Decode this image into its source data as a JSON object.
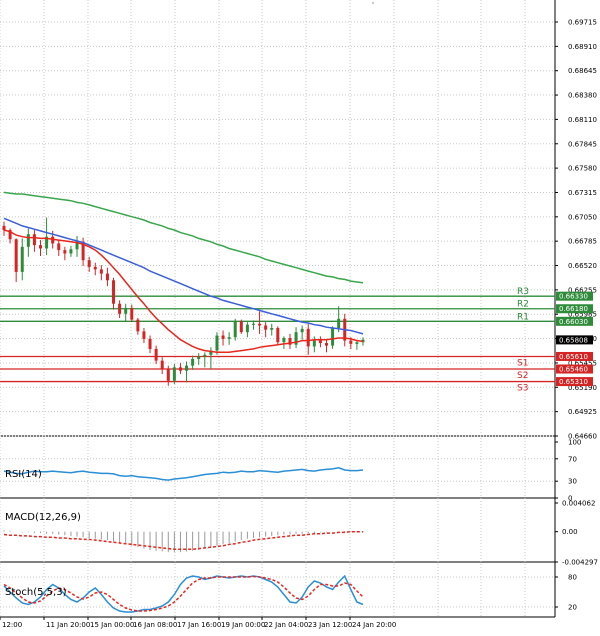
{
  "colors": {
    "bull": "#2e8b3a",
    "bear": "#d42424",
    "ma_fast": "#e8261c",
    "ma_mid": "#3a5fd9",
    "ma_slow": "#3aa64c",
    "support": "#d42424",
    "resistance": "#2e8b3a",
    "rsi": "#2a8fd6",
    "stoch_main": "#2a8fd6",
    "stoch_signal": "#e8261c",
    "macd_hist": "#9a9a9a",
    "macd_signal": "#e8261c",
    "grid": "#000000",
    "price_box": "#000000"
  },
  "chart_data": [
    {
      "type": "candlestick",
      "panel": "price",
      "ylim": [
        0.6466,
        0.6982
      ],
      "y_ticks": [
        "0.69715",
        "0.68910",
        "0.68645",
        "0.68380",
        "0.68110",
        "0.67845",
        "0.67580",
        "0.67315",
        "0.67050",
        "0.66785",
        "0.66520",
        "0.66255",
        "0.65985",
        "0.65720",
        "0.65455",
        "0.65190",
        "0.64925",
        "0.64660"
      ],
      "x_ticks": [
        "12:00",
        "11 Jan 20:00",
        "15 Jan 00:00",
        "16 Jan 08:00",
        "17 Jan 16:00",
        "19 Jan 00:00",
        "22 Jan 04:00",
        "23 Jan 12:00",
        "24 Jan 20:00"
      ],
      "last_price": "0.65808",
      "levels": [
        {
          "name": "R3",
          "value": 0.6633,
          "label": "0.66330",
          "kind": "resistance"
        },
        {
          "name": "R2",
          "value": 0.6618,
          "label": "0.66180",
          "kind": "resistance"
        },
        {
          "name": "R1",
          "value": 0.6603,
          "label": "0.66030",
          "kind": "resistance"
        },
        {
          "name": "S1",
          "value": 0.6561,
          "label": "0.65610",
          "kind": "support"
        },
        {
          "name": "S2",
          "value": 0.6546,
          "label": "0.65460",
          "kind": "support"
        },
        {
          "name": "S3",
          "value": 0.6531,
          "label": "0.65310",
          "kind": "support"
        }
      ],
      "candles": [
        [
          0.6717,
          0.6722,
          0.6705,
          0.6712
        ],
        [
          0.6712,
          0.6714,
          0.6696,
          0.6701
        ],
        [
          0.6701,
          0.6702,
          0.665,
          0.6662
        ],
        [
          0.6662,
          0.6702,
          0.6652,
          0.6692
        ],
        [
          0.6692,
          0.6714,
          0.668,
          0.6707
        ],
        [
          0.6707,
          0.6712,
          0.6686,
          0.6694
        ],
        [
          0.6694,
          0.67,
          0.6681,
          0.669
        ],
        [
          0.669,
          0.6727,
          0.6682,
          0.6704
        ],
        [
          0.6704,
          0.6711,
          0.669,
          0.6696
        ],
        [
          0.6696,
          0.67,
          0.6681,
          0.6688
        ],
        [
          0.6688,
          0.6692,
          0.6676,
          0.6684
        ],
        [
          0.6684,
          0.6693,
          0.668,
          0.6689
        ],
        [
          0.6689,
          0.6705,
          0.668,
          0.6698
        ],
        [
          0.6698,
          0.6703,
          0.6669,
          0.6676
        ],
        [
          0.6676,
          0.668,
          0.6662,
          0.6668
        ],
        [
          0.6668,
          0.6673,
          0.6658,
          0.6665
        ],
        [
          0.6665,
          0.667,
          0.6652,
          0.666
        ],
        [
          0.666,
          0.6667,
          0.6645,
          0.6652
        ],
        [
          0.6652,
          0.6655,
          0.6617,
          0.6624
        ],
        [
          0.6624,
          0.6628,
          0.6607,
          0.6612
        ],
        [
          0.6612,
          0.6624,
          0.6603,
          0.6619
        ],
        [
          0.6619,
          0.6623,
          0.6602,
          0.6605
        ],
        [
          0.6605,
          0.6607,
          0.6587,
          0.6591
        ],
        [
          0.6591,
          0.6595,
          0.6577,
          0.6582
        ],
        [
          0.6582,
          0.6586,
          0.6565,
          0.657
        ],
        [
          0.657,
          0.6574,
          0.6552,
          0.6556
        ],
        [
          0.6556,
          0.656,
          0.654,
          0.6546
        ],
        [
          0.6546,
          0.655,
          0.6526,
          0.6532
        ],
        [
          0.6532,
          0.6552,
          0.6528,
          0.6548
        ],
        [
          0.6548,
          0.6553,
          0.654,
          0.6544
        ],
        [
          0.6544,
          0.6555,
          0.653,
          0.655
        ],
        [
          0.655,
          0.6562,
          0.6545,
          0.6558
        ],
        [
          0.6558,
          0.6565,
          0.6551,
          0.6561
        ],
        [
          0.6561,
          0.6566,
          0.6548,
          0.6563
        ],
        [
          0.6563,
          0.6572,
          0.6546,
          0.6568
        ],
        [
          0.6568,
          0.659,
          0.6563,
          0.6586
        ],
        [
          0.6586,
          0.6592,
          0.6574,
          0.6582
        ],
        [
          0.6582,
          0.659,
          0.6575,
          0.6584
        ],
        [
          0.6584,
          0.6606,
          0.658,
          0.6603
        ],
        [
          0.6603,
          0.6605,
          0.6588,
          0.659
        ],
        [
          0.659,
          0.6602,
          0.6584,
          0.6599
        ],
        [
          0.6599,
          0.6604,
          0.6593,
          0.66
        ],
        [
          0.66,
          0.6615,
          0.6588,
          0.6598
        ],
        [
          0.6598,
          0.6602,
          0.6584,
          0.6593
        ],
        [
          0.6593,
          0.66,
          0.6586,
          0.6595
        ],
        [
          0.6595,
          0.6597,
          0.6575,
          0.6578
        ],
        [
          0.6578,
          0.6585,
          0.657,
          0.6583
        ],
        [
          0.6583,
          0.6588,
          0.657,
          0.6575
        ],
        [
          0.6575,
          0.6596,
          0.6571,
          0.659
        ],
        [
          0.659,
          0.6598,
          0.6581,
          0.6594
        ],
        [
          0.6594,
          0.66,
          0.6563,
          0.6573
        ],
        [
          0.6573,
          0.6585,
          0.6566,
          0.658
        ],
        [
          0.658,
          0.6585,
          0.6572,
          0.6577
        ],
        [
          0.6577,
          0.6582,
          0.6566,
          0.6574
        ],
        [
          0.6574,
          0.6597,
          0.657,
          0.6595
        ],
        [
          0.6595,
          0.6621,
          0.659,
          0.6606
        ],
        [
          0.6606,
          0.6612,
          0.6573,
          0.658
        ],
        [
          0.658,
          0.6584,
          0.657,
          0.6576
        ],
        [
          0.6576,
          0.658,
          0.6569,
          0.6578
        ],
        [
          0.6578,
          0.6584,
          0.6574,
          0.6581
        ]
      ],
      "ma_fast": [
        0.6712,
        0.671,
        0.6706,
        0.6704,
        0.6703,
        0.6703,
        0.6702,
        0.6702,
        0.6701,
        0.67,
        0.6699,
        0.6698,
        0.6697,
        0.6695,
        0.6692,
        0.6688,
        0.6682,
        0.6675,
        0.6667,
        0.6659,
        0.665,
        0.6641,
        0.6632,
        0.6624,
        0.6615,
        0.6607,
        0.66,
        0.6593,
        0.6587,
        0.6581,
        0.6577,
        0.6573,
        0.657,
        0.6568,
        0.6567,
        0.6566,
        0.6566,
        0.6566,
        0.6567,
        0.6568,
        0.6569,
        0.657,
        0.6572,
        0.6573,
        0.6574,
        0.6575,
        0.6576,
        0.6577,
        0.6578,
        0.658,
        0.658,
        0.6581,
        0.6581,
        0.6581,
        0.6582,
        0.6583,
        0.6583,
        0.6582,
        0.658,
        0.6579
      ],
      "ma_mid": [
        0.6726,
        0.6723,
        0.672,
        0.6717,
        0.6715,
        0.6713,
        0.6711,
        0.6709,
        0.6707,
        0.6705,
        0.6703,
        0.6701,
        0.6699,
        0.6697,
        0.6694,
        0.6691,
        0.6688,
        0.6685,
        0.6682,
        0.6679,
        0.6676,
        0.6673,
        0.667,
        0.6667,
        0.6663,
        0.666,
        0.6657,
        0.6654,
        0.6651,
        0.6648,
        0.6645,
        0.6642,
        0.6639,
        0.6636,
        0.6633,
        0.6631,
        0.6628,
        0.6626,
        0.6624,
        0.6622,
        0.662,
        0.6618,
        0.6616,
        0.6614,
        0.6612,
        0.661,
        0.6608,
        0.6606,
        0.6604,
        0.6602,
        0.6601,
        0.6599,
        0.6598,
        0.6596,
        0.6595,
        0.6594,
        0.6593,
        0.6592,
        0.659,
        0.6588
      ],
      "ma_slow": [
        0.6757,
        0.6756,
        0.6755,
        0.6755,
        0.6754,
        0.6753,
        0.6752,
        0.6751,
        0.675,
        0.6749,
        0.6748,
        0.6747,
        0.6745,
        0.6744,
        0.6742,
        0.674,
        0.6738,
        0.6736,
        0.6734,
        0.6732,
        0.673,
        0.6728,
        0.6726,
        0.6724,
        0.6721,
        0.6719,
        0.6717,
        0.6714,
        0.6712,
        0.6709,
        0.6707,
        0.6705,
        0.6702,
        0.67,
        0.6698,
        0.6695,
        0.6693,
        0.669,
        0.6688,
        0.6686,
        0.6684,
        0.6682,
        0.668,
        0.6677,
        0.6675,
        0.6673,
        0.6671,
        0.6669,
        0.6667,
        0.6665,
        0.6663,
        0.6661,
        0.6659,
        0.6657,
        0.6656,
        0.6654,
        0.6653,
        0.6651,
        0.665,
        0.6649
      ]
    },
    {
      "type": "line",
      "panel": "rsi",
      "label": "RSI(14)",
      "ylim": [
        0,
        100
      ],
      "y_ticks": [
        "100",
        "70",
        "30",
        "0"
      ],
      "values": [
        48,
        46,
        44,
        43,
        46,
        48,
        47,
        47,
        48,
        47,
        46,
        45,
        47,
        48,
        46,
        45,
        44,
        44,
        43,
        40,
        39,
        40,
        38,
        37,
        36,
        35,
        33,
        32,
        34,
        35,
        36,
        38,
        40,
        42,
        43,
        44,
        46,
        45,
        46,
        48,
        47,
        47,
        49,
        48,
        47,
        46,
        48,
        49,
        50,
        51,
        49,
        48,
        50,
        51,
        52,
        54,
        50,
        49,
        49,
        50
      ]
    },
    {
      "type": "bar",
      "panel": "macd",
      "label": "MACD(12,26,9)",
      "ylim": [
        -0.004297,
        0.004062
      ],
      "y_ticks": [
        "0.004062",
        "0.00",
        "-0.004297"
      ],
      "hist": [
        0.0002,
        0.0001,
        0.0,
        -0.0001,
        -0.0001,
        -0.0002,
        -0.0002,
        -0.0003,
        -0.0003,
        -0.0004,
        -0.0005,
        -0.0006,
        -0.0007,
        -0.0008,
        -0.0009,
        -0.001,
        -0.0011,
        -0.0012,
        -0.0014,
        -0.0016,
        -0.0018,
        -0.002,
        -0.0022,
        -0.0024,
        -0.0026,
        -0.0027,
        -0.0028,
        -0.0029,
        -0.0029,
        -0.0029,
        -0.0028,
        -0.0027,
        -0.0026,
        -0.0024,
        -0.0022,
        -0.002,
        -0.0018,
        -0.0016,
        -0.0014,
        -0.0012,
        -0.001,
        -0.0009,
        -0.0008,
        -0.0007,
        -0.0006,
        -0.0005,
        -0.0004,
        -0.0004,
        -0.0003,
        -0.0003,
        -0.0002,
        -0.0002,
        -0.0001,
        -0.0001,
        0.0,
        0.0,
        0.0001,
        0.0001,
        0.0001,
        0.0001
      ],
      "signal": [
        -0.0004,
        -0.0005,
        -0.0005,
        -0.0006,
        -0.0006,
        -0.0007,
        -0.0007,
        -0.0008,
        -0.0008,
        -0.0009,
        -0.0009,
        -0.001,
        -0.001,
        -0.0011,
        -0.0011,
        -0.0012,
        -0.0013,
        -0.0014,
        -0.0015,
        -0.0016,
        -0.0017,
        -0.0018,
        -0.0019,
        -0.002,
        -0.0021,
        -0.0022,
        -0.0023,
        -0.0024,
        -0.0025,
        -0.0025,
        -0.0025,
        -0.0025,
        -0.0024,
        -0.0023,
        -0.0022,
        -0.0021,
        -0.002,
        -0.0018,
        -0.0017,
        -0.0015,
        -0.0014,
        -0.0012,
        -0.0011,
        -0.001,
        -0.0009,
        -0.0008,
        -0.0007,
        -0.0006,
        -0.0005,
        -0.0005,
        -0.0004,
        -0.0003,
        -0.0003,
        -0.0002,
        -0.0002,
        -0.0001,
        -0.0001,
        0.0,
        0.0,
        0.0
      ]
    },
    {
      "type": "line",
      "panel": "stoch",
      "label": "Stoch(5,5,3)",
      "ylim": [
        0,
        100
      ],
      "y_ticks": [
        "80",
        "20"
      ],
      "main": [
        62,
        50,
        38,
        28,
        25,
        30,
        40,
        55,
        65,
        58,
        45,
        35,
        30,
        38,
        50,
        58,
        45,
        30,
        18,
        12,
        10,
        10,
        12,
        15,
        15,
        18,
        22,
        30,
        45,
        65,
        78,
        82,
        80,
        75,
        78,
        82,
        80,
        78,
        80,
        82,
        80,
        82,
        80,
        75,
        70,
        60,
        45,
        30,
        28,
        40,
        60,
        72,
        68,
        60,
        55,
        70,
        82,
        55,
        30,
        25
      ],
      "signal": [
        65,
        58,
        48,
        38,
        30,
        28,
        32,
        42,
        52,
        58,
        55,
        48,
        40,
        36,
        40,
        48,
        50,
        45,
        35,
        25,
        18,
        14,
        12,
        12,
        13,
        15,
        18,
        22,
        30,
        42,
        55,
        68,
        75,
        78,
        78,
        80,
        80,
        80,
        80,
        80,
        80,
        81,
        80,
        78,
        75,
        70,
        60,
        48,
        38,
        35,
        42,
        55,
        65,
        65,
        62,
        62,
        68,
        65,
        52,
        40
      ]
    }
  ]
}
